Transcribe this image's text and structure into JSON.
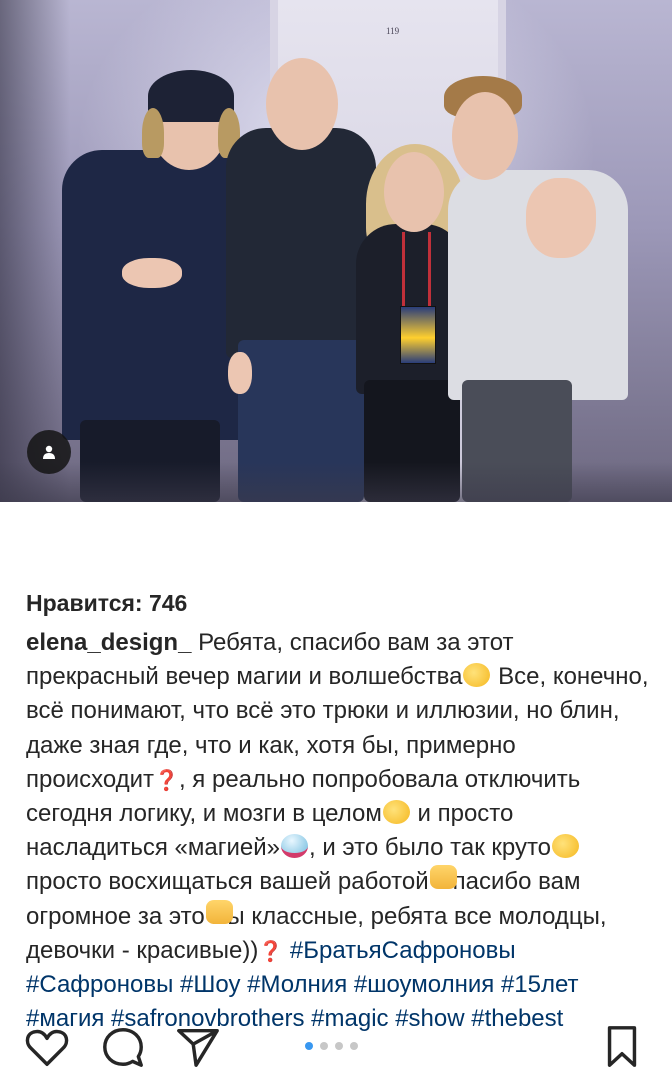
{
  "photo": {
    "door_number": "119",
    "tag_icon": "person-icon"
  },
  "actions": {
    "like_icon": "heart-outline-icon",
    "comment_icon": "comment-bubble-icon",
    "share_icon": "paper-plane-icon",
    "save_icon": "bookmark-icon",
    "carousel": {
      "count": 4,
      "active_index": 0
    }
  },
  "likes": {
    "text": "Нравится: 746"
  },
  "caption": {
    "username": "elena_design_",
    "part1": " Ребята, спасибо вам за этот прекрасный вечер магии и волшебства",
    "part2": " Все, конечно, всё понимают, что всё это трюки и иллюзии, но блин, даже зная где, что и как, хотя бы, примерно происходит",
    "unknown_glyph": "❓",
    "part3": ", я реально попробовала отключить сегодня логику, и мозги в целом",
    "part4": " и просто насладиться «магией»",
    "part5": ", и это было так круто",
    "part6": " просто восхищаться вашей работой",
    "part7": " Спасибо вам огромное за это",
    "part8": " Вы классные, ребята все молодцы, девочки - красивые))",
    "hashtags": [
      "#БратьяСафроновы",
      "#Сафроновы",
      "#Шоу",
      "#Молния",
      "#шоумолния",
      "#15лет",
      "#магия",
      "#safronovbrothers",
      "#magic",
      "#show",
      "#thebest"
    ]
  },
  "colors": {
    "hashtag": "#003569",
    "text": "#262626",
    "carousel_active": "#3897f0",
    "carousel_inactive": "#c7c7c7"
  }
}
